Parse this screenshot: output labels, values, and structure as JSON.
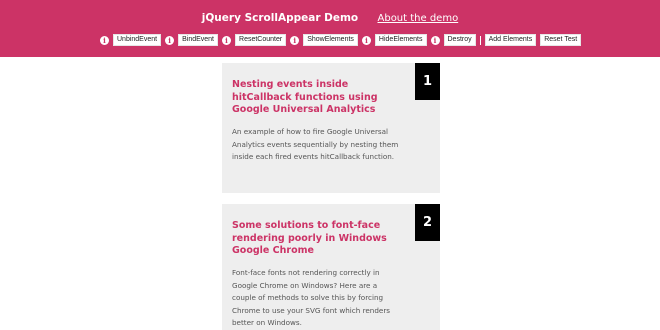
{
  "header": {
    "title": "jQuery ScrollAppear Demo",
    "about_link": "About the demo"
  },
  "controls": [
    {
      "label": "UnbindEvent"
    },
    {
      "label": "BindEvent"
    },
    {
      "label": "ResetCounter"
    },
    {
      "label": "ShowElements"
    },
    {
      "label": "HideElements"
    },
    {
      "label": "Destroy"
    },
    {
      "label": "Add Elements"
    },
    {
      "label": "Reset Test"
    }
  ],
  "info_icon_glyph": "i",
  "cards": [
    {
      "number": "1",
      "title": "Nesting events inside hitCallback functions using Google Universal Analytics",
      "body": "An example of how to fire Google Universal Analytics events sequentially by nesting them inside each fired events hitCallback function."
    },
    {
      "number": "2",
      "title": "Some solutions to font-face rendering poorly in Windows Google Chrome",
      "body": "Font-face fonts not rendering correctly in Google Chrome on Windows? Here are a couple of methods to solve this by forcing Chrome to use your SVG font which renders better on Windows."
    }
  ],
  "colors": {
    "brand": "#cc3366",
    "card_bg": "#eeeeee",
    "badge_bg": "#000000"
  },
  "icons": [
    "info-icon"
  ]
}
